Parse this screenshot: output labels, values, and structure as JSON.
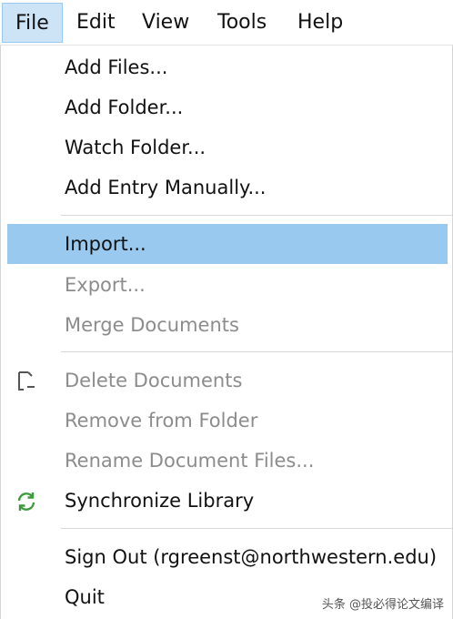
{
  "menubar": {
    "items": [
      {
        "label": "File"
      },
      {
        "label": "Edit"
      },
      {
        "label": "View"
      },
      {
        "label": "Tools"
      },
      {
        "label": "Help"
      }
    ]
  },
  "file_menu": {
    "items": [
      {
        "label": "Add Files...",
        "enabled": true
      },
      {
        "label": "Add Folder...",
        "enabled": true
      },
      {
        "label": "Watch Folder...",
        "enabled": true
      },
      {
        "label": "Add Entry Manually...",
        "enabled": true
      },
      {
        "label": "Import...",
        "enabled": true,
        "highlighted": true
      },
      {
        "label": "Export...",
        "enabled": false
      },
      {
        "label": "Merge Documents",
        "enabled": false
      },
      {
        "label": "Delete Documents",
        "enabled": false,
        "icon": "delete-document-icon"
      },
      {
        "label": "Remove from Folder",
        "enabled": false
      },
      {
        "label": "Rename Document Files...",
        "enabled": false
      },
      {
        "label": "Synchronize Library",
        "enabled": true,
        "icon": "sync-icon"
      },
      {
        "label": "Sign Out (rgreenst@northwestern.edu)",
        "enabled": true
      },
      {
        "label": "Quit",
        "enabled": true
      }
    ]
  },
  "colors": {
    "highlight": "#99c9ef",
    "active_menu_bg": "#cde4f7",
    "disabled_text": "#8c8c8c",
    "sync_icon": "#3a9a3a"
  },
  "watermark": "头条 @投必得论文编译"
}
